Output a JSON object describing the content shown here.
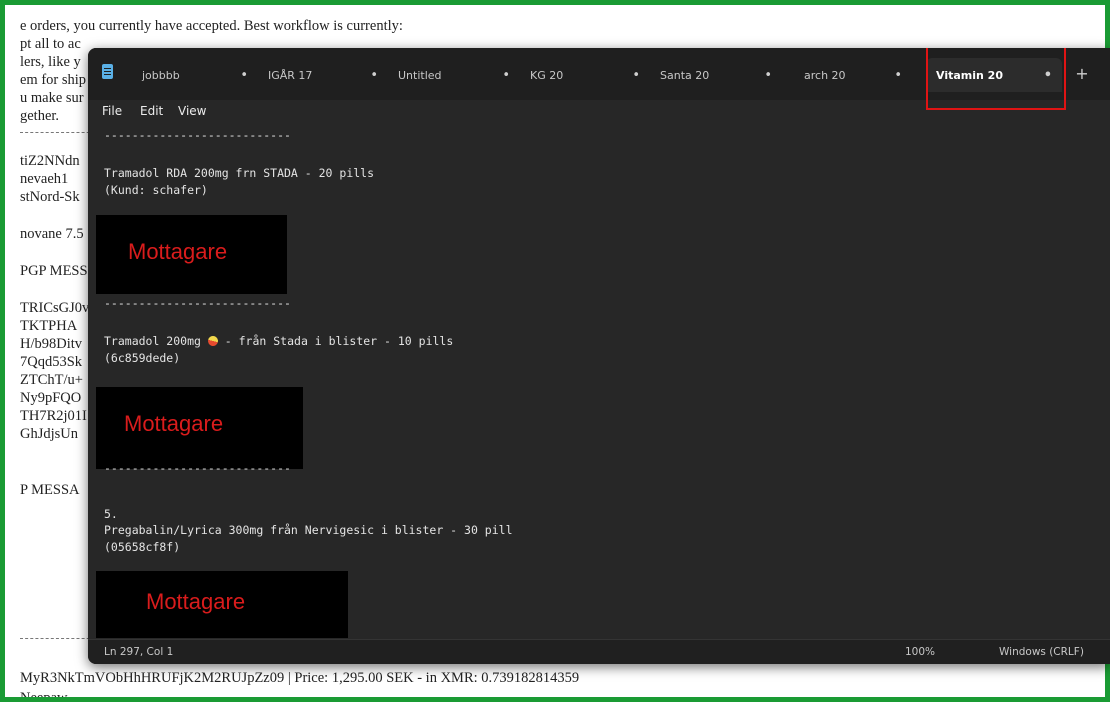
{
  "background_doc": {
    "lines": [
      "e orders, you currently have accepted. Best workflow is currently:",
      "pt all to ac",
      "lers, like y",
      "em for ship",
      "u make sur",
      "gether.",
      "tiZ2NNdn",
      "nevaeh1",
      "stNord-Sk",
      "novane 7.5",
      "PGP MESS",
      "TRICsGJ0v",
      "TKTPHA",
      "H/b98Ditv",
      "7Qqd53Sk",
      "ZTChT/u+",
      "Ny9pFQO",
      "TH7R2j01I",
      "GhJdjsUn",
      "P MESSA",
      "MyR3NkTmVObHhHRUFjK2M2RUJpZz09 | Price: 1,295.00 SEK - in XMR: 0.739182814359",
      "Neepaw"
    ]
  },
  "notepad": {
    "tabs": [
      {
        "label": "jobbbb",
        "modified": "•"
      },
      {
        "label": "IGÅR 17",
        "modified": "•"
      },
      {
        "label": "Untitled",
        "modified": "•"
      },
      {
        "label": "KG 20",
        "modified": "•"
      },
      {
        "label": "Santa 20",
        "modified": "•"
      },
      {
        "label": "arch 20",
        "modified": "•"
      },
      {
        "label": "Vitamin 20",
        "modified": "•",
        "active": true
      }
    ],
    "new_tab": "+",
    "menu": [
      "File",
      "Edit",
      "View"
    ],
    "content": {
      "sep1": "---------------------------",
      "item1_line1": "Tramadol RDA 200mg frn STADA - 20 pills",
      "item1_line2": "(Kund: schafer)",
      "redact1": "Mottagare",
      "sep2": "---------------------------",
      "item2_line1_a": "Tramadol 200mg ",
      "item2_line1_b": " - från Stada i blister - 10 pills",
      "item2_line2": "(6c859dede)",
      "redact2": "Mottagare",
      "sep3": "---------------------------",
      "item3_num": "5.",
      "item3_line1": "Pregabalin/Lyrica 300mg från Nervigesic i blister - 30 pill",
      "item3_line2": "(05658cf8f)",
      "redact3": "Mottagare"
    },
    "status": {
      "position": "Ln 297, Col 1",
      "zoom": "100%",
      "line_ending": "Windows (CRLF)"
    }
  },
  "colors": {
    "frame_border": "#1a9b34",
    "highlight_box": "#e01414",
    "redaction_text": "#d91c1c",
    "editor_bg": "#272727"
  }
}
